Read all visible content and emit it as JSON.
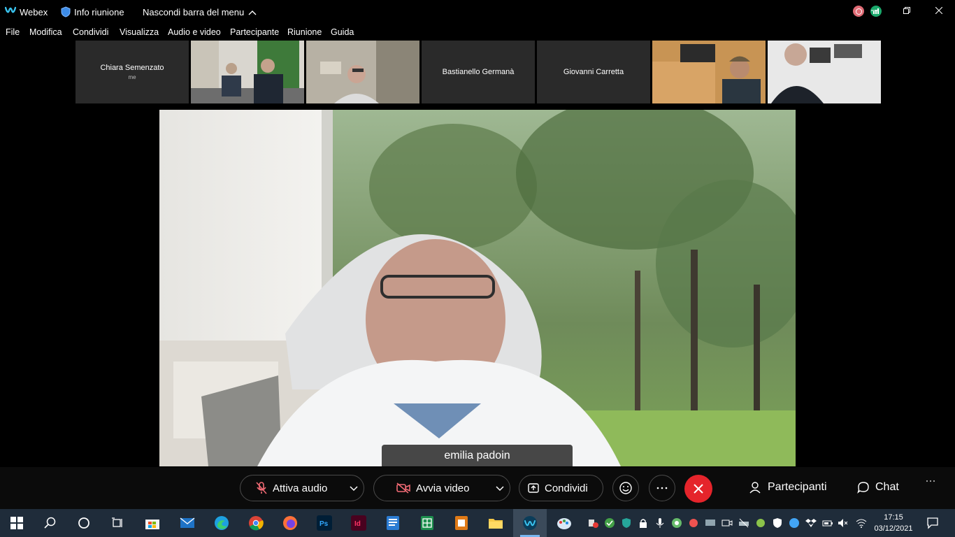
{
  "titlebar": {
    "app_name": "Webex",
    "info_label": "Info riunione",
    "hide_menu_label": "Nascondi barra del menu"
  },
  "menu": [
    "File",
    "Modifica",
    "Condividi",
    "Visualizza",
    "Audio e video",
    "Partecipante",
    "Riunione",
    "Guida"
  ],
  "thumbnails": [
    {
      "name": "Chiara Semenzato",
      "sub": "me",
      "video": false
    },
    {
      "name": "",
      "sub": "",
      "video": true
    },
    {
      "name": "",
      "sub": "",
      "video": true
    },
    {
      "name": "Bastianello Germanà",
      "sub": "",
      "video": false
    },
    {
      "name": "Giovanni Carretta",
      "sub": "",
      "video": false
    },
    {
      "name": "",
      "sub": "",
      "video": true
    },
    {
      "name": "",
      "sub": "",
      "video": true
    }
  ],
  "active_speaker": "emilia padoin",
  "controls": {
    "audio_label": "Attiva audio",
    "video_label": "Avvia video",
    "share_label": "Condividi",
    "participants_label": "Partecipanti",
    "chat_label": "Chat"
  },
  "clock": {
    "time": "17:15",
    "date": "03/12/2021"
  },
  "colors": {
    "end_call": "#e5242b",
    "record": "#e06b75",
    "stats": "#1aa86b",
    "taskbar": "#1f2c3a"
  }
}
